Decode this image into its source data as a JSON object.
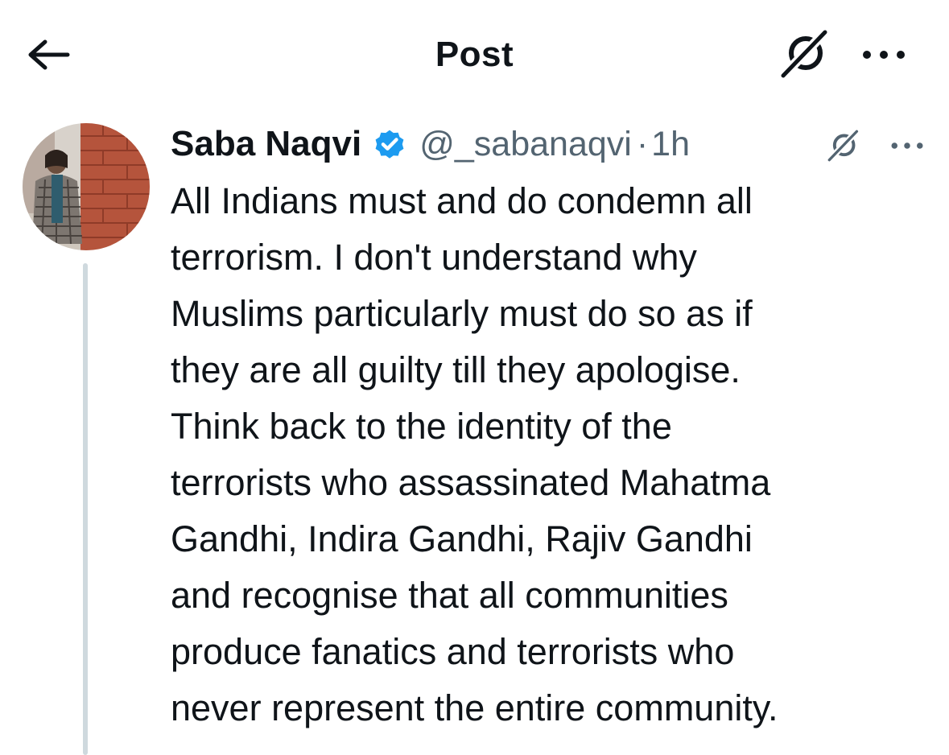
{
  "header": {
    "title": "Post",
    "back_icon": "arrow-left-icon",
    "grok_icon": "grok-icon",
    "more_icon": "more-horizontal-icon"
  },
  "post": {
    "author": {
      "name": "Saba Naqvi",
      "handle": "@_sabanaqvi",
      "verified": true,
      "verified_color": "#1d9bf0"
    },
    "separator": "·",
    "time": "1h",
    "text_lines": [
      "All Indians must and do condemn all",
      "terrorism. I don't understand why",
      "Muslims particularly must do so as if",
      "they are all guilty till they apologise.",
      "Think back to the identity of the",
      "terrorists who assassinated Mahatma",
      "Gandhi, Indira Gandhi, Rajiv Gandhi",
      "and recognise that all communities",
      "produce fanatics and terrorists who",
      "never represent the entire community."
    ]
  },
  "colors": {
    "text_primary": "#0f1419",
    "text_secondary": "#536471",
    "thread_line": "#cfd9de",
    "accent": "#1d9bf0"
  }
}
